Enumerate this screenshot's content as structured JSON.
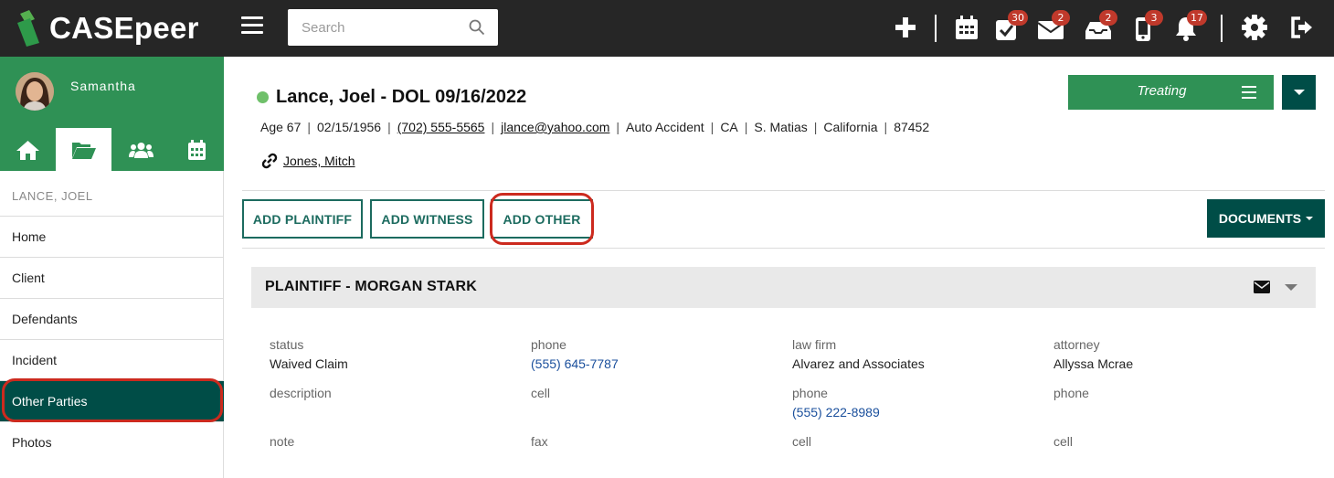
{
  "topbar": {
    "brand": "CASEpeer",
    "search_placeholder": "Search",
    "icons": [
      {
        "name": "plus-icon"
      },
      {
        "name": "calendar-icon"
      },
      {
        "name": "tasks-icon",
        "badge": "30"
      },
      {
        "name": "mail-icon",
        "badge": "2"
      },
      {
        "name": "inbox-icon",
        "badge": "2"
      },
      {
        "name": "phone-icon",
        "badge": "3"
      },
      {
        "name": "bell-icon",
        "badge": "17"
      },
      {
        "name": "gear-icon"
      },
      {
        "name": "sign-out-icon"
      }
    ]
  },
  "sidebar": {
    "user_name": "Samantha",
    "case_name": "LANCE, JOEL",
    "nav_icons": [
      "home-icon",
      "folder-open-icon",
      "users-icon",
      "calendar-icon"
    ],
    "active_nav_icon": "folder-open-icon",
    "items": [
      {
        "label": "Home"
      },
      {
        "label": "Client"
      },
      {
        "label": "Defendants"
      },
      {
        "label": "Incident"
      },
      {
        "label": "Other Parties",
        "active": true
      },
      {
        "label": "Photos"
      }
    ]
  },
  "case": {
    "title": "Lance, Joel - DOL 09/16/2022",
    "status_color": "#6fc06a",
    "age": "Age 67",
    "dob": "02/15/1956",
    "phone": "(702) 555-5565",
    "email": "jlance@yahoo.com",
    "case_type": "Auto Accident",
    "state_code": "CA",
    "city": "S. Matias",
    "state": "California",
    "zip": "87452",
    "linked_contact": "Jones, Mitch",
    "status_label": "Treating"
  },
  "actions": {
    "add_plaintiff": "ADD PLAINTIFF",
    "add_witness": "ADD WITNESS",
    "add_other": "ADD OTHER",
    "documents": "DOCUMENTS"
  },
  "panel": {
    "title": "PLAINTIFF - MORGAN STARK",
    "fields": {
      "status": {
        "label": "status",
        "value": "Waived Claim"
      },
      "phone": {
        "label": "phone",
        "value": "(555) 645-7787"
      },
      "law_firm": {
        "label": "law firm",
        "value": "Alvarez and Associates"
      },
      "attorney": {
        "label": "attorney",
        "value": "Allyssa Mcrae"
      },
      "description": {
        "label": "description",
        "value": ""
      },
      "cell": {
        "label": "cell",
        "value": ""
      },
      "firm_phone": {
        "label": "phone",
        "value": "(555) 222-8989"
      },
      "attorney_phone": {
        "label": "phone",
        "value": ""
      },
      "note": {
        "label": "note",
        "value": ""
      },
      "fax": {
        "label": "fax",
        "value": ""
      },
      "firm_cell": {
        "label": "cell",
        "value": ""
      },
      "attorney_cell": {
        "label": "cell",
        "value": ""
      }
    }
  },
  "colors": {
    "topbar": "#262626",
    "brand_green": "#2f9155",
    "dark_teal": "#004d47",
    "highlight_red": "#cc2a1e",
    "link_blue": "#1a4f9c"
  }
}
